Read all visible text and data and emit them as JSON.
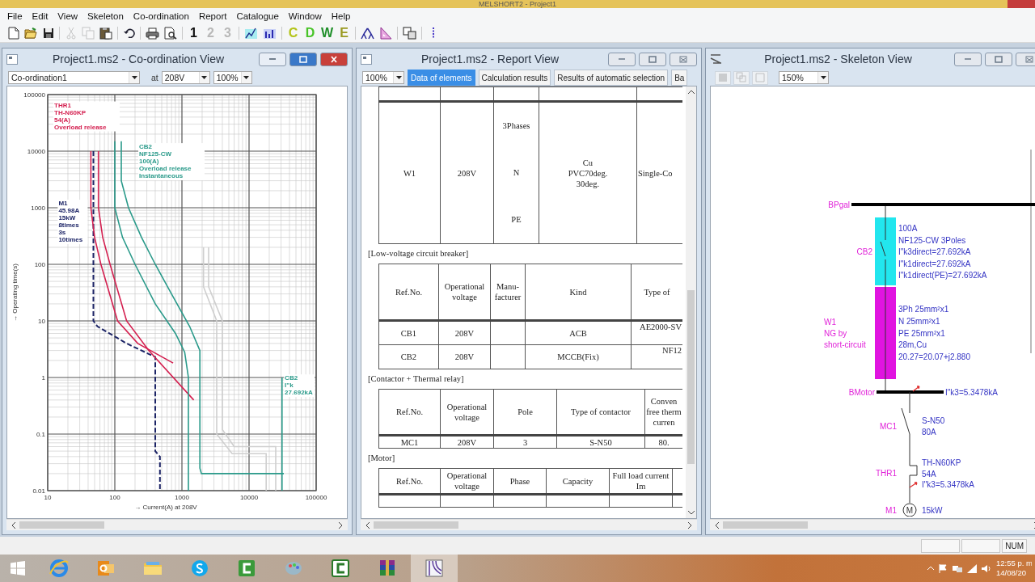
{
  "app": {
    "title": "MELSHORT2 - Project1"
  },
  "menu": [
    "File",
    "Edit",
    "View",
    "Skeleton",
    "Co-ordination",
    "Report",
    "Catalogue",
    "Window",
    "Help"
  ],
  "toolbar": [
    {
      "kind": "new",
      "disabled": false
    },
    {
      "kind": "open",
      "disabled": false
    },
    {
      "kind": "save",
      "disabled": false
    },
    {
      "kind": "sep"
    },
    {
      "kind": "cut",
      "disabled": true
    },
    {
      "kind": "copy",
      "disabled": true
    },
    {
      "kind": "paste",
      "disabled": false
    },
    {
      "kind": "sep"
    },
    {
      "kind": "undo",
      "disabled": false
    },
    {
      "kind": "sep"
    },
    {
      "kind": "print",
      "disabled": false
    },
    {
      "kind": "preview",
      "disabled": false
    },
    {
      "kind": "sep"
    },
    {
      "kind": "text",
      "label": "1",
      "disabled": false
    },
    {
      "kind": "text",
      "label": "2",
      "disabled": true
    },
    {
      "kind": "text",
      "label": "3",
      "disabled": true
    },
    {
      "kind": "sep"
    },
    {
      "kind": "chart",
      "disabled": false
    },
    {
      "kind": "bars",
      "disabled": false
    },
    {
      "kind": "sep"
    },
    {
      "kind": "text",
      "label": "C",
      "color": "#b4c41a",
      "disabled": false
    },
    {
      "kind": "text",
      "label": "D",
      "color": "#48c428",
      "disabled": false
    },
    {
      "kind": "text",
      "label": "W",
      "color": "#1f8f2a",
      "disabled": false
    },
    {
      "kind": "text",
      "label": "E",
      "color": "#9a9a22",
      "disabled": false
    },
    {
      "kind": "sep"
    },
    {
      "kind": "tree",
      "disabled": false
    },
    {
      "kind": "triangle",
      "disabled": false
    },
    {
      "kind": "sep"
    },
    {
      "kind": "pages",
      "disabled": false
    },
    {
      "kind": "sep"
    },
    {
      "kind": "dots",
      "disabled": false
    }
  ],
  "coordination": {
    "title": "Project1.ms2 - Co-ordination View",
    "active": true,
    "selector": "Co-ordination1",
    "at_label": "at",
    "voltage": "208V",
    "zoom": "100%",
    "chart": {
      "x_title": "→ Current(A) at 208V",
      "y_title": "→ Operating time(s)",
      "x_ticks": [
        "10",
        "100",
        "1000",
        "10000",
        "100000"
      ],
      "y_ticks": [
        "100000",
        "10000",
        "1000",
        "100",
        "10",
        "1",
        "0.1",
        "0.01"
      ],
      "curve_labels": [
        {
          "lines": [
            "THR1",
            "TH-N60KP",
            "54(A)",
            "Overload release"
          ],
          "color": "#d42050"
        },
        {
          "lines": [
            "CB2",
            "NF125-CW",
            "100(A)",
            "Overload release",
            "Instantaneous"
          ],
          "color": "#2a9a8a"
        },
        {
          "lines": [
            "M1",
            "45.98A",
            "15kW",
            "8times",
            "3s",
            "10times"
          ],
          "color": "#1c2466"
        },
        {
          "lines": [
            "CB2",
            "I\"k",
            "27.692kA"
          ],
          "color": "#2a9a8a"
        }
      ]
    }
  },
  "report": {
    "title": "Project1.ms2 - Report View",
    "active": false,
    "zoom": "100%",
    "tabs": [
      {
        "label": "Data of elements",
        "selected": true
      },
      {
        "label": "Calculation results",
        "selected": false
      },
      {
        "label": "Results of automatic selection",
        "selected": false
      },
      {
        "label": "Ba",
        "selected": false
      }
    ],
    "tables": [
      {
        "rows": [
          [
            "W1",
            "208V",
            [
              "3Phases",
              "N",
              "PE"
            ],
            [
              "Cu",
              "PVC70deg.",
              "30deg."
            ],
            "Single-Co"
          ]
        ]
      },
      {
        "heading": "[Low-voltage circuit breaker]",
        "columns": [
          "Ref.No.",
          "Operational voltage",
          "Manu-facturer",
          "Kind",
          "Type of"
        ],
        "rows": [
          [
            "CB1",
            "208V",
            null,
            "ACB",
            "AE2000-SV"
          ],
          [
            "CB2",
            "208V",
            null,
            "MCCB(Fix)",
            "NF12"
          ]
        ]
      },
      {
        "heading": "[Contactor + Thermal relay]",
        "columns": [
          "Ref.No.",
          "Operational voltage",
          "Pole",
          "Type of contactor",
          "Conven free therm curren"
        ],
        "rows": [
          [
            "MC1",
            "208V",
            "3",
            "S-N50",
            "80."
          ]
        ]
      },
      {
        "heading": "[Motor]",
        "columns": [
          "Ref.No.",
          "Operational voltage",
          "Phase",
          "Capacity",
          "Full load current Im"
        ]
      }
    ]
  },
  "skeleton": {
    "title": "Project1.ms2 - Skeleton View",
    "active": false,
    "zoom": "150%",
    "diagram": {
      "main_bus": {
        "label": "BPgal"
      },
      "breaker": {
        "label": "CB2",
        "specs": [
          "100A",
          "NF125-CW 3Poles",
          "I\"k3direct=27.692kA",
          "I\"k1direct=27.692kA",
          "I\"k1direct(PE)=27.692kA"
        ]
      },
      "cable": {
        "label": [
          "W1",
          "NG by",
          "short-circuit"
        ],
        "specs": [
          "3Ph 25mm²x1",
          "N 25mm²x1",
          "PE 25mm²x1",
          "28m,Cu",
          "20.27=20.07+j2.880"
        ]
      },
      "motor_bus": {
        "label": "BMotor",
        "fault": "I\"k3=5.3478kA"
      },
      "contactor": {
        "label": "MC1",
        "specs": [
          "S-N50",
          "80A"
        ]
      },
      "thermal_relay": {
        "label": "THR1",
        "specs": [
          "TH-N60KP",
          "54A",
          "I\"k3=5.3478kA"
        ]
      },
      "motor": {
        "label": "M1",
        "symbol": "M",
        "specs": [
          "15kW"
        ]
      }
    }
  },
  "status_bar": {
    "indicators": [
      "NUM"
    ]
  },
  "taskbar": {
    "apps": [
      {
        "kind": "ie",
        "selected": false
      },
      {
        "kind": "outlook",
        "selected": false
      },
      {
        "kind": "explorer",
        "selected": false
      },
      {
        "kind": "skype",
        "selected": false
      },
      {
        "kind": "camtasia",
        "selected": false
      },
      {
        "kind": "paint",
        "selected": false
      },
      {
        "kind": "recorder",
        "selected": false
      },
      {
        "kind": "archive",
        "selected": false
      },
      {
        "kind": "melshort",
        "selected": true
      }
    ],
    "clock": {
      "time": "12:55 p. m",
      "date": "14/08/20"
    }
  }
}
